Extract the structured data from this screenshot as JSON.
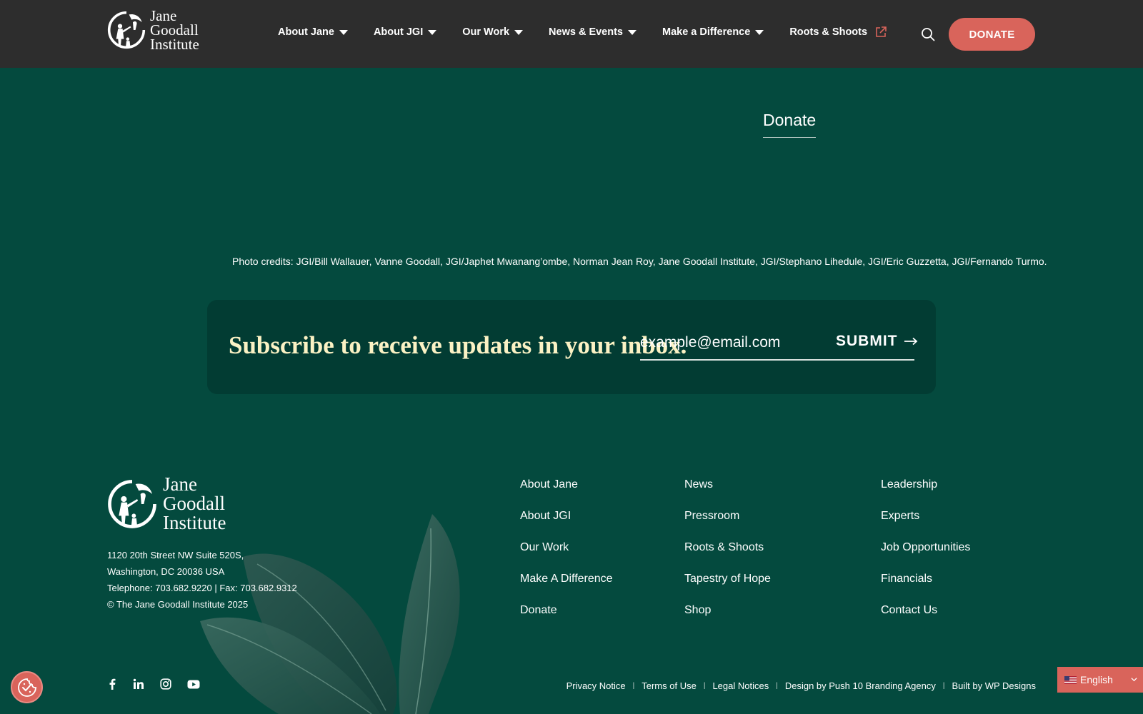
{
  "header": {
    "logo_lines": [
      "Jane",
      "Goodall",
      "Institute"
    ],
    "nav": [
      {
        "label": "About Jane",
        "has_dropdown": true
      },
      {
        "label": "About JGI",
        "has_dropdown": true
      },
      {
        "label": "Our Work",
        "has_dropdown": true
      },
      {
        "label": "News & Events",
        "has_dropdown": true
      },
      {
        "label": "Make a Difference",
        "has_dropdown": true
      },
      {
        "label": "Roots & Shoots",
        "external": true
      }
    ],
    "donate_label": "DONATE"
  },
  "main": {
    "donate_link": "Donate",
    "photo_credits": "Photo credits: JGI/Bill Wallauer, Vanne Goodall, JGI/Japhet Mwanang’ombe, Norman Jean Roy, Jane Goodall Institute, JGI/Stephano Lihedule, JGI/Eric Guzzetta, JGI/Fernando Turmo."
  },
  "subscribe": {
    "heading": "Subscribe to receive updates in your inbox.",
    "email_placeholder": "example@email.com",
    "submit_label": "SUBMIT"
  },
  "footer": {
    "logo_lines": [
      "Jane",
      "Goodall",
      "Institute"
    ],
    "address": [
      "1120 20th Street NW Suite 520S,",
      "Washington, DC 20036 USA",
      "Telephone: 703.682.9220 | Fax: 703.682.9312",
      "© The Jane Goodall Institute 2025"
    ],
    "columns": [
      [
        "About Jane",
        "About JGI",
        "Our Work",
        "Make A Difference",
        "Donate"
      ],
      [
        "News",
        "Pressroom",
        "Roots & Shoots",
        "Tapestry of Hope",
        "Shop"
      ],
      [
        "Leadership",
        "Experts",
        "Job Opportunities",
        "Financials",
        "Contact Us"
      ]
    ],
    "social_icons": [
      "facebook-icon",
      "linkedin-icon",
      "instagram-icon",
      "youtube-icon"
    ],
    "legal_links": [
      "Privacy Notice",
      "Terms of Use",
      "Legal Notices",
      "Design by Push 10 Branding Agency",
      "Built by WP Designs"
    ]
  },
  "language": {
    "selected": "English"
  },
  "colors": {
    "header_bg": "#2d2d2d",
    "page_bg": "#044a3e",
    "accent": "#d9645b",
    "subscribe_bg": "#023c33",
    "subscribe_heading": "#fbf2c4"
  }
}
